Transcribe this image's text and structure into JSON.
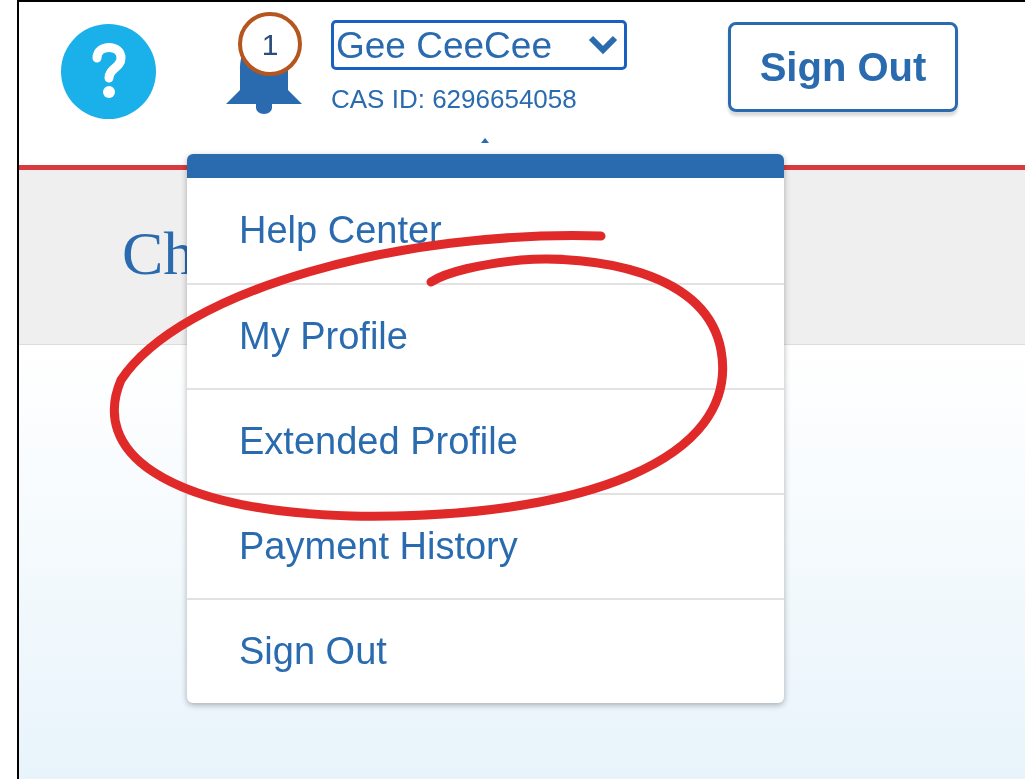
{
  "header": {
    "notification_count": "1",
    "user_name": "Gee CeeCee",
    "cas_id": "CAS ID: 6296654058",
    "sign_out": "Sign Out"
  },
  "page": {
    "heading": "Ch"
  },
  "menu": {
    "items": [
      {
        "label": "Help Center"
      },
      {
        "label": "My Profile"
      },
      {
        "label": "Extended Profile"
      },
      {
        "label": "Payment History"
      },
      {
        "label": "Sign Out"
      }
    ]
  }
}
